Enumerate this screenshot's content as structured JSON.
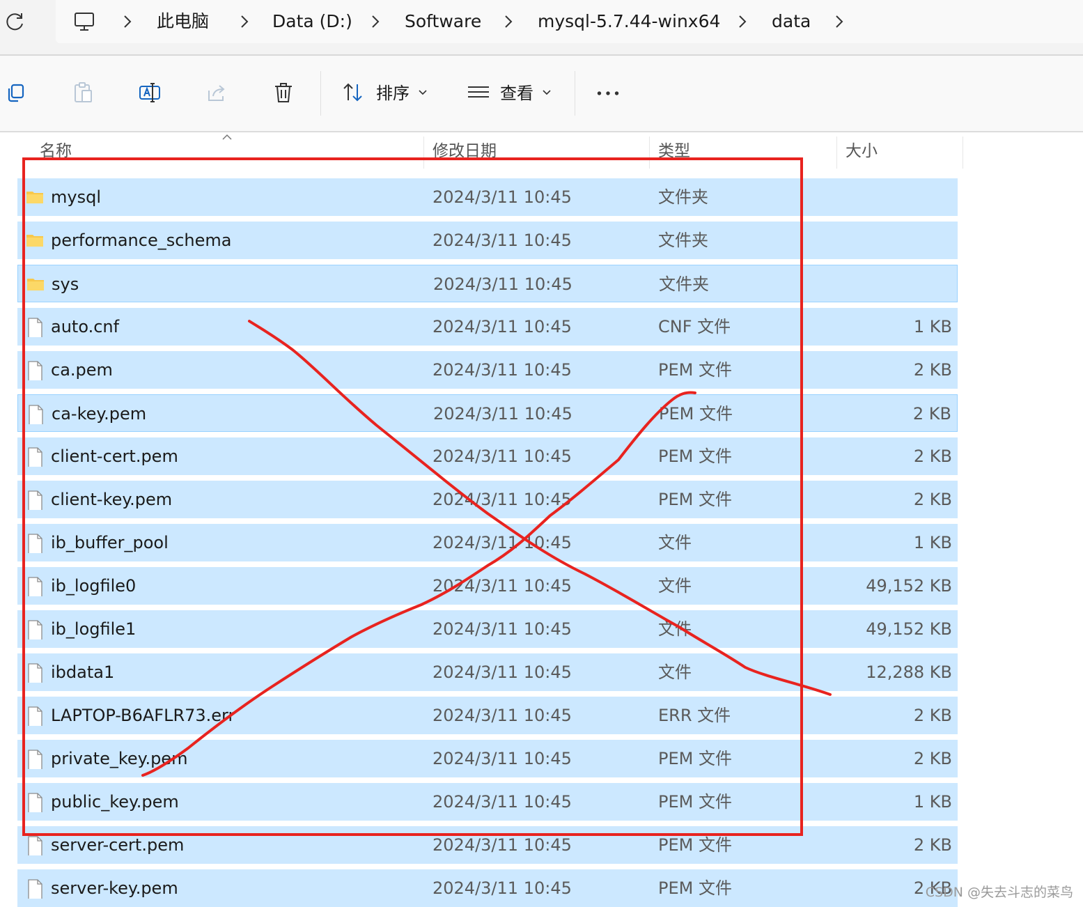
{
  "breadcrumb": [
    "此电脑",
    "Data (D:)",
    "Software",
    "mysql-5.7.44-winx64",
    "data"
  ],
  "toolbar": {
    "sort_label": "排序",
    "view_label": "查看"
  },
  "columns": {
    "name": "名称",
    "modified": "修改日期",
    "type": "类型",
    "size": "大小"
  },
  "files": [
    {
      "kind": "folder",
      "name": "mysql",
      "modified": "2024/3/11 10:45",
      "type": "文件夹",
      "size": ""
    },
    {
      "kind": "folder",
      "name": "performance_schema",
      "modified": "2024/3/11 10:45",
      "type": "文件夹",
      "size": ""
    },
    {
      "kind": "folder",
      "name": "sys",
      "modified": "2024/3/11 10:45",
      "type": "文件夹",
      "size": ""
    },
    {
      "kind": "file",
      "name": "auto.cnf",
      "modified": "2024/3/11 10:45",
      "type": "CNF 文件",
      "size": "1 KB"
    },
    {
      "kind": "file",
      "name": "ca.pem",
      "modified": "2024/3/11 10:45",
      "type": "PEM 文件",
      "size": "2 KB"
    },
    {
      "kind": "file",
      "name": "ca-key.pem",
      "modified": "2024/3/11 10:45",
      "type": "PEM 文件",
      "size": "2 KB"
    },
    {
      "kind": "file",
      "name": "client-cert.pem",
      "modified": "2024/3/11 10:45",
      "type": "PEM 文件",
      "size": "2 KB"
    },
    {
      "kind": "file",
      "name": "client-key.pem",
      "modified": "2024/3/11 10:45",
      "type": "PEM 文件",
      "size": "2 KB"
    },
    {
      "kind": "file",
      "name": "ib_buffer_pool",
      "modified": "2024/3/11 10:45",
      "type": "文件",
      "size": "1 KB"
    },
    {
      "kind": "file",
      "name": "ib_logfile0",
      "modified": "2024/3/11 10:45",
      "type": "文件",
      "size": "49,152 KB"
    },
    {
      "kind": "file",
      "name": "ib_logfile1",
      "modified": "2024/3/11 10:45",
      "type": "文件",
      "size": "49,152 KB"
    },
    {
      "kind": "file",
      "name": "ibdata1",
      "modified": "2024/3/11 10:45",
      "type": "文件",
      "size": "12,288 KB"
    },
    {
      "kind": "file",
      "name": "LAPTOP-B6AFLR73.err",
      "modified": "2024/3/11 10:45",
      "type": "ERR 文件",
      "size": "2 KB"
    },
    {
      "kind": "file",
      "name": "private_key.pem",
      "modified": "2024/3/11 10:45",
      "type": "PEM 文件",
      "size": "2 KB"
    },
    {
      "kind": "file",
      "name": "public_key.pem",
      "modified": "2024/3/11 10:45",
      "type": "PEM 文件",
      "size": "1 KB"
    },
    {
      "kind": "file",
      "name": "server-cert.pem",
      "modified": "2024/3/11 10:45",
      "type": "PEM 文件",
      "size": "2 KB"
    },
    {
      "kind": "file",
      "name": "server-key.pem",
      "modified": "2024/3/11 10:45",
      "type": "PEM 文件",
      "size": "2 KB"
    }
  ],
  "watermark": "CSDN @失去斗志的菜鸟",
  "colors": {
    "selection": "#cce8ff",
    "annotation": "#e8231f",
    "folder": "#f8c84a"
  }
}
